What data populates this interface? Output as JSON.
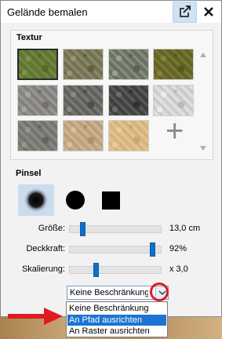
{
  "window": {
    "title": "Gelände bemalen"
  },
  "texture_section": {
    "heading": "Textur",
    "tiles": [
      {
        "name": "texture-grass-green",
        "colors": [
          "#657b37",
          "#7e9447",
          "#546a2c"
        ],
        "selected": true
      },
      {
        "name": "texture-grass-rocky",
        "colors": [
          "#7b7a5b",
          "#9b9775",
          "#64613f"
        ],
        "selected": false
      },
      {
        "name": "texture-grass-stones",
        "colors": [
          "#727b6a",
          "#9ea495",
          "#586350"
        ],
        "selected": false
      },
      {
        "name": "texture-moss",
        "colors": [
          "#6b6a2c",
          "#86853a",
          "#55551f"
        ],
        "selected": false
      },
      {
        "name": "texture-gravel",
        "colors": [
          "#8b8986",
          "#aaa7a3",
          "#74726e"
        ],
        "selected": false
      },
      {
        "name": "texture-cobblestone",
        "colors": [
          "#6a6965",
          "#8b8a86",
          "#4f4e4a"
        ],
        "selected": false
      },
      {
        "name": "texture-dark-rock",
        "colors": [
          "#494a48",
          "#6c6d6a",
          "#313230"
        ],
        "selected": false
      },
      {
        "name": "texture-snow",
        "colors": [
          "#d4d5d6",
          "#eeeeee",
          "#b9babb"
        ],
        "selected": false
      },
      {
        "name": "texture-concrete",
        "colors": [
          "#7b7d76",
          "#95978f",
          "#63655e"
        ],
        "selected": false
      },
      {
        "name": "texture-sand",
        "colors": [
          "#c4a884",
          "#d8c09e",
          "#ad926f"
        ],
        "selected": false
      },
      {
        "name": "texture-wood",
        "colors": [
          "#dcba86",
          "#e9cd9e",
          "#c9a671"
        ],
        "selected": false
      }
    ],
    "add_symbol": "+"
  },
  "brush_section": {
    "heading": "Pinsel",
    "shapes": [
      {
        "name": "brush-soft",
        "selected": true
      },
      {
        "name": "brush-circle",
        "selected": false
      },
      {
        "name": "brush-square",
        "selected": false
      }
    ],
    "sliders": [
      {
        "key": "size",
        "label": "Größe:",
        "value_text": "13,0 cm",
        "fraction": 0.12
      },
      {
        "key": "opacity",
        "label": "Deckkraft:",
        "value_text": "92%",
        "fraction": 0.92
      },
      {
        "key": "scale",
        "label": "Skalierung:",
        "value_text": "x 3,0",
        "fraction": 0.27
      }
    ]
  },
  "alignment": {
    "current_value": "Keine Beschränkung",
    "options": [
      "Keine Beschränkung",
      "An Pfad ausrichten",
      "An Raster ausrichten"
    ],
    "highlighted_option": "An Pfad ausrichten"
  },
  "colors": {
    "accent": "#1070c6",
    "selection": "#1c73d3",
    "annotation": "#e01b22"
  }
}
